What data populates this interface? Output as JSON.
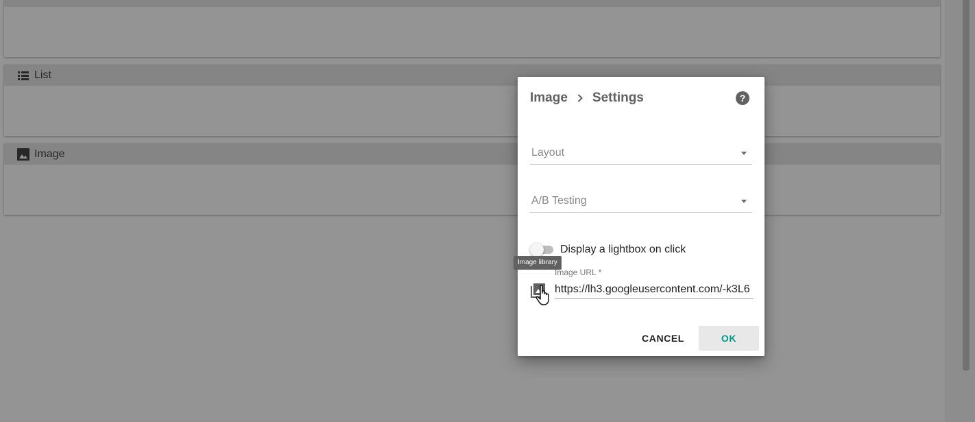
{
  "background": {
    "sections": [
      {
        "label": "",
        "icon": ""
      },
      {
        "label": "List",
        "icon": "list-icon"
      },
      {
        "label": "Image",
        "icon": "image-icon"
      }
    ]
  },
  "dialog": {
    "breadcrumb": {
      "parent": "Image",
      "current": "Settings"
    },
    "help_icon": "help-circle-icon",
    "layout_placeholder": "Layout",
    "ab_testing_placeholder": "A/B Testing",
    "lightbox_label": "Display a lightbox on click",
    "lightbox_enabled": false,
    "image_url": {
      "label": "Image URL *",
      "value": "https://lh3.googleusercontent.com/-k3L6"
    },
    "image_library_icon": "image-library-icon",
    "tooltip": "Image library",
    "buttons": {
      "cancel": "CANCEL",
      "ok": "OK"
    }
  },
  "colors": {
    "accent": "#009688",
    "overlay": "rgba(0,0,0,0.42)",
    "section_header": "#e6e6e6"
  }
}
